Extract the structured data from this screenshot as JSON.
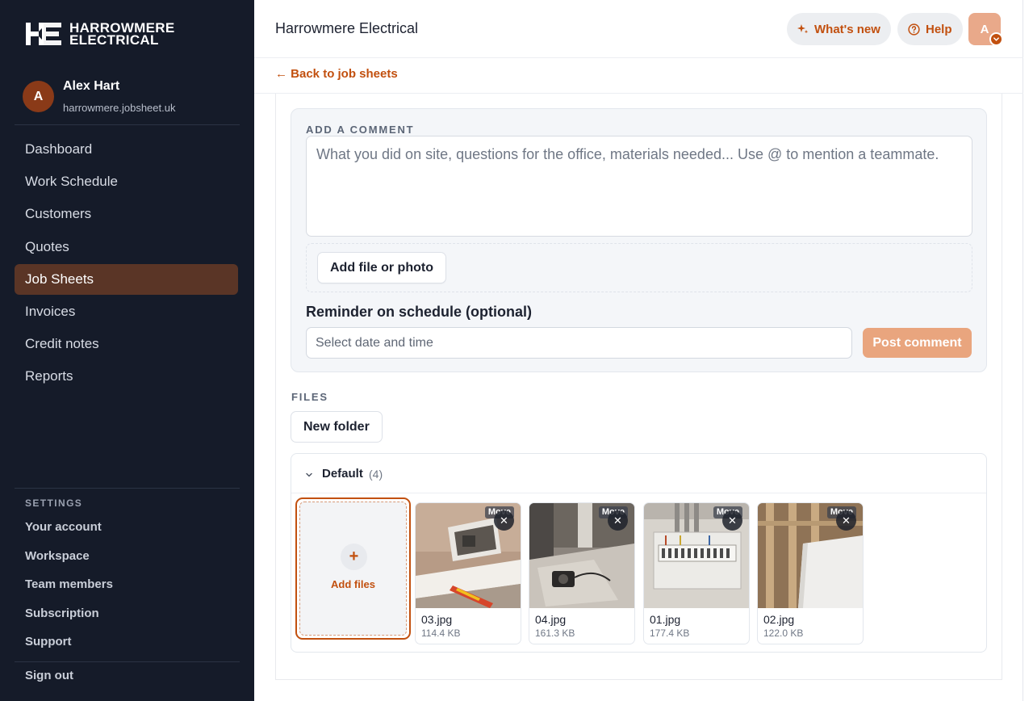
{
  "brand": {
    "line1": "HARROWMERE",
    "line2": "ELECTRICAL",
    "mark": "HE"
  },
  "user": {
    "initial": "A",
    "name": "Alex Hart",
    "domain": "harrowmere.jobsheet.uk"
  },
  "nav": {
    "items": [
      {
        "label": "Dashboard"
      },
      {
        "label": "Work Schedule"
      },
      {
        "label": "Customers"
      },
      {
        "label": "Quotes"
      },
      {
        "label": "Job Sheets",
        "active": true
      },
      {
        "label": "Invoices"
      },
      {
        "label": "Credit notes"
      },
      {
        "label": "Reports"
      }
    ]
  },
  "settings": {
    "label": "SETTINGS",
    "items": [
      {
        "label": "Your account"
      },
      {
        "label": "Workspace"
      },
      {
        "label": "Team members"
      },
      {
        "label": "Subscription"
      },
      {
        "label": "Support"
      }
    ],
    "signout": "Sign out"
  },
  "header": {
    "title": "Harrowmere Electrical",
    "whats_new": "What's new",
    "help": "Help",
    "avatar_initial": "A"
  },
  "back": {
    "label": "← Back to job sheets"
  },
  "comment": {
    "label": "ADD A COMMENT",
    "placeholder": "What you did on site, questions for the office, materials needed... Use @ to mention a teammate.",
    "add_file_label": "Add file or photo",
    "reminder_label": "Reminder on schedule (optional)",
    "datetime_placeholder": "Select date and time",
    "post_label": "Post comment"
  },
  "files": {
    "label": "FILES",
    "new_folder_label": "New folder",
    "folder": {
      "name": "Default",
      "count": "(4)"
    },
    "add_files_label": "Add files",
    "move_label": "Move",
    "items": [
      {
        "name": "03.jpg",
        "size": "114.4 KB"
      },
      {
        "name": "04.jpg",
        "size": "161.3 KB"
      },
      {
        "name": "01.jpg",
        "size": "177.4 KB"
      },
      {
        "name": "02.jpg",
        "size": "122.0 KB"
      }
    ]
  },
  "colors": {
    "accent": "#c2500f",
    "sidebar_bg": "#151b29",
    "active_nav_bg": "#5a3526",
    "post_button": "#e9a57e"
  }
}
